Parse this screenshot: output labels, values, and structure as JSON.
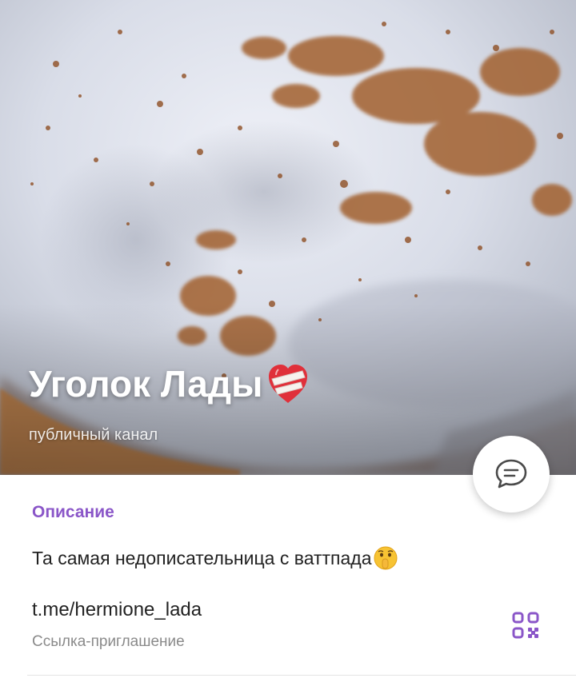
{
  "channel": {
    "title": "Уголок Лады",
    "title_icon": "mending-heart-icon",
    "type_label": "публичный канал",
    "cover_icon": "latte-foam-photo"
  },
  "actions": {
    "chat_icon": "chat-bubble-icon",
    "qr_icon": "qr-code-icon"
  },
  "info": {
    "section_label": "Описание",
    "description": "Та самая недописательница с ваттпада",
    "description_icon": "shushing-face-icon",
    "link": "t.me/hermione_lada",
    "link_caption": "Ссылка-приглашение"
  },
  "colors": {
    "accent": "#8a56c8",
    "text": "#222222",
    "muted": "#8a8a8a",
    "heart": "#e0303a"
  }
}
